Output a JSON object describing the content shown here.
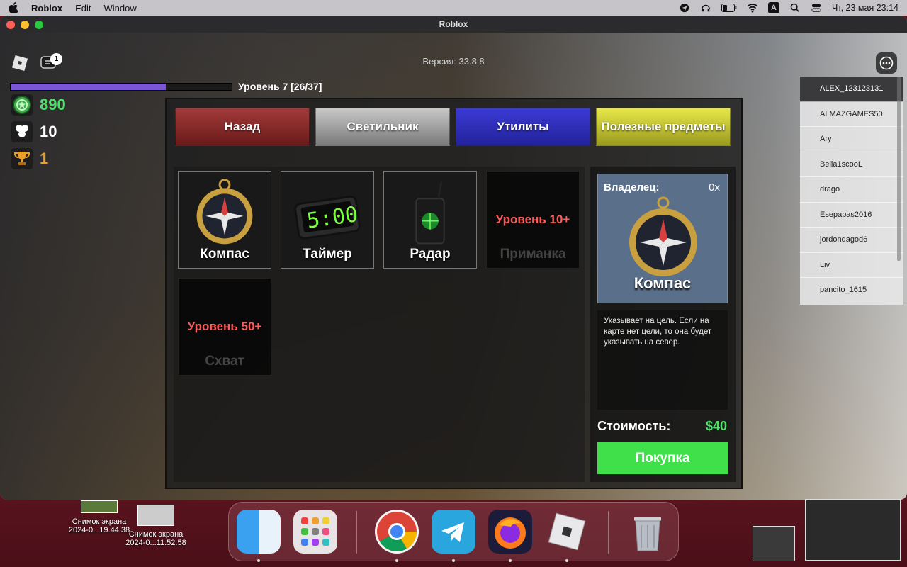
{
  "menubar": {
    "app": "Roblox",
    "items": [
      "Edit",
      "Window"
    ],
    "clock": "Чт, 23 мая  23:14",
    "input_source": "A"
  },
  "window": {
    "title": "Roblox"
  },
  "hud": {
    "version": "Версия: 33.8.8",
    "chat_badge": "1",
    "level_text": "Уровень 7 [26/37]",
    "xp_progress": 0.703,
    "stats": [
      {
        "icon": "coin-icon",
        "value": "890",
        "color": "#4ee06a"
      },
      {
        "icon": "hexagon-icon",
        "value": "10",
        "color": "#ffffff"
      },
      {
        "icon": "trophy-icon",
        "value": "1",
        "color": "#e8a02a"
      }
    ]
  },
  "players": [
    "ALEX_123123131",
    "ALMAZGAMES50",
    "Ary",
    "Bella1scooL",
    "drago",
    "Esepapas2016",
    "jordondagod6",
    "Liv",
    "pancito_1615"
  ],
  "shop": {
    "tabs": [
      {
        "label": "Назад"
      },
      {
        "label": "Светильник"
      },
      {
        "label": "Утилиты"
      },
      {
        "label": "Полезные предметы"
      }
    ],
    "items": [
      {
        "label": "Компас",
        "locked": false,
        "lock_text": ""
      },
      {
        "label": "Таймер",
        "locked": false,
        "lock_text": "",
        "display": "5:00"
      },
      {
        "label": "Радар",
        "locked": false,
        "lock_text": ""
      },
      {
        "label": "Приманка",
        "locked": true,
        "lock_text": "Уровень 10+"
      },
      {
        "label": "Схват",
        "locked": true,
        "lock_text": "Уровень 50+"
      }
    ],
    "detail": {
      "owner_label": "Владелец:",
      "owner_count": "0x",
      "name": "Компас",
      "description": "Указывает на цель. Если на карте нет цели, то она будет указывать на север.",
      "price_label": "Стоимость:",
      "price": "$40",
      "buy_label": "Покупка"
    }
  },
  "desktop": {
    "files": [
      {
        "line1": "Снимок экрана",
        "line2": "2024-0...19.44.38"
      },
      {
        "line1": "Снимок экрана",
        "line2": "2024-0...11.52.58"
      }
    ]
  },
  "dock": [
    "finder-icon",
    "launchpad-icon",
    "chrome-icon",
    "telegram-icon",
    "firefox-icon",
    "roblox-icon",
    "trash-icon"
  ]
}
